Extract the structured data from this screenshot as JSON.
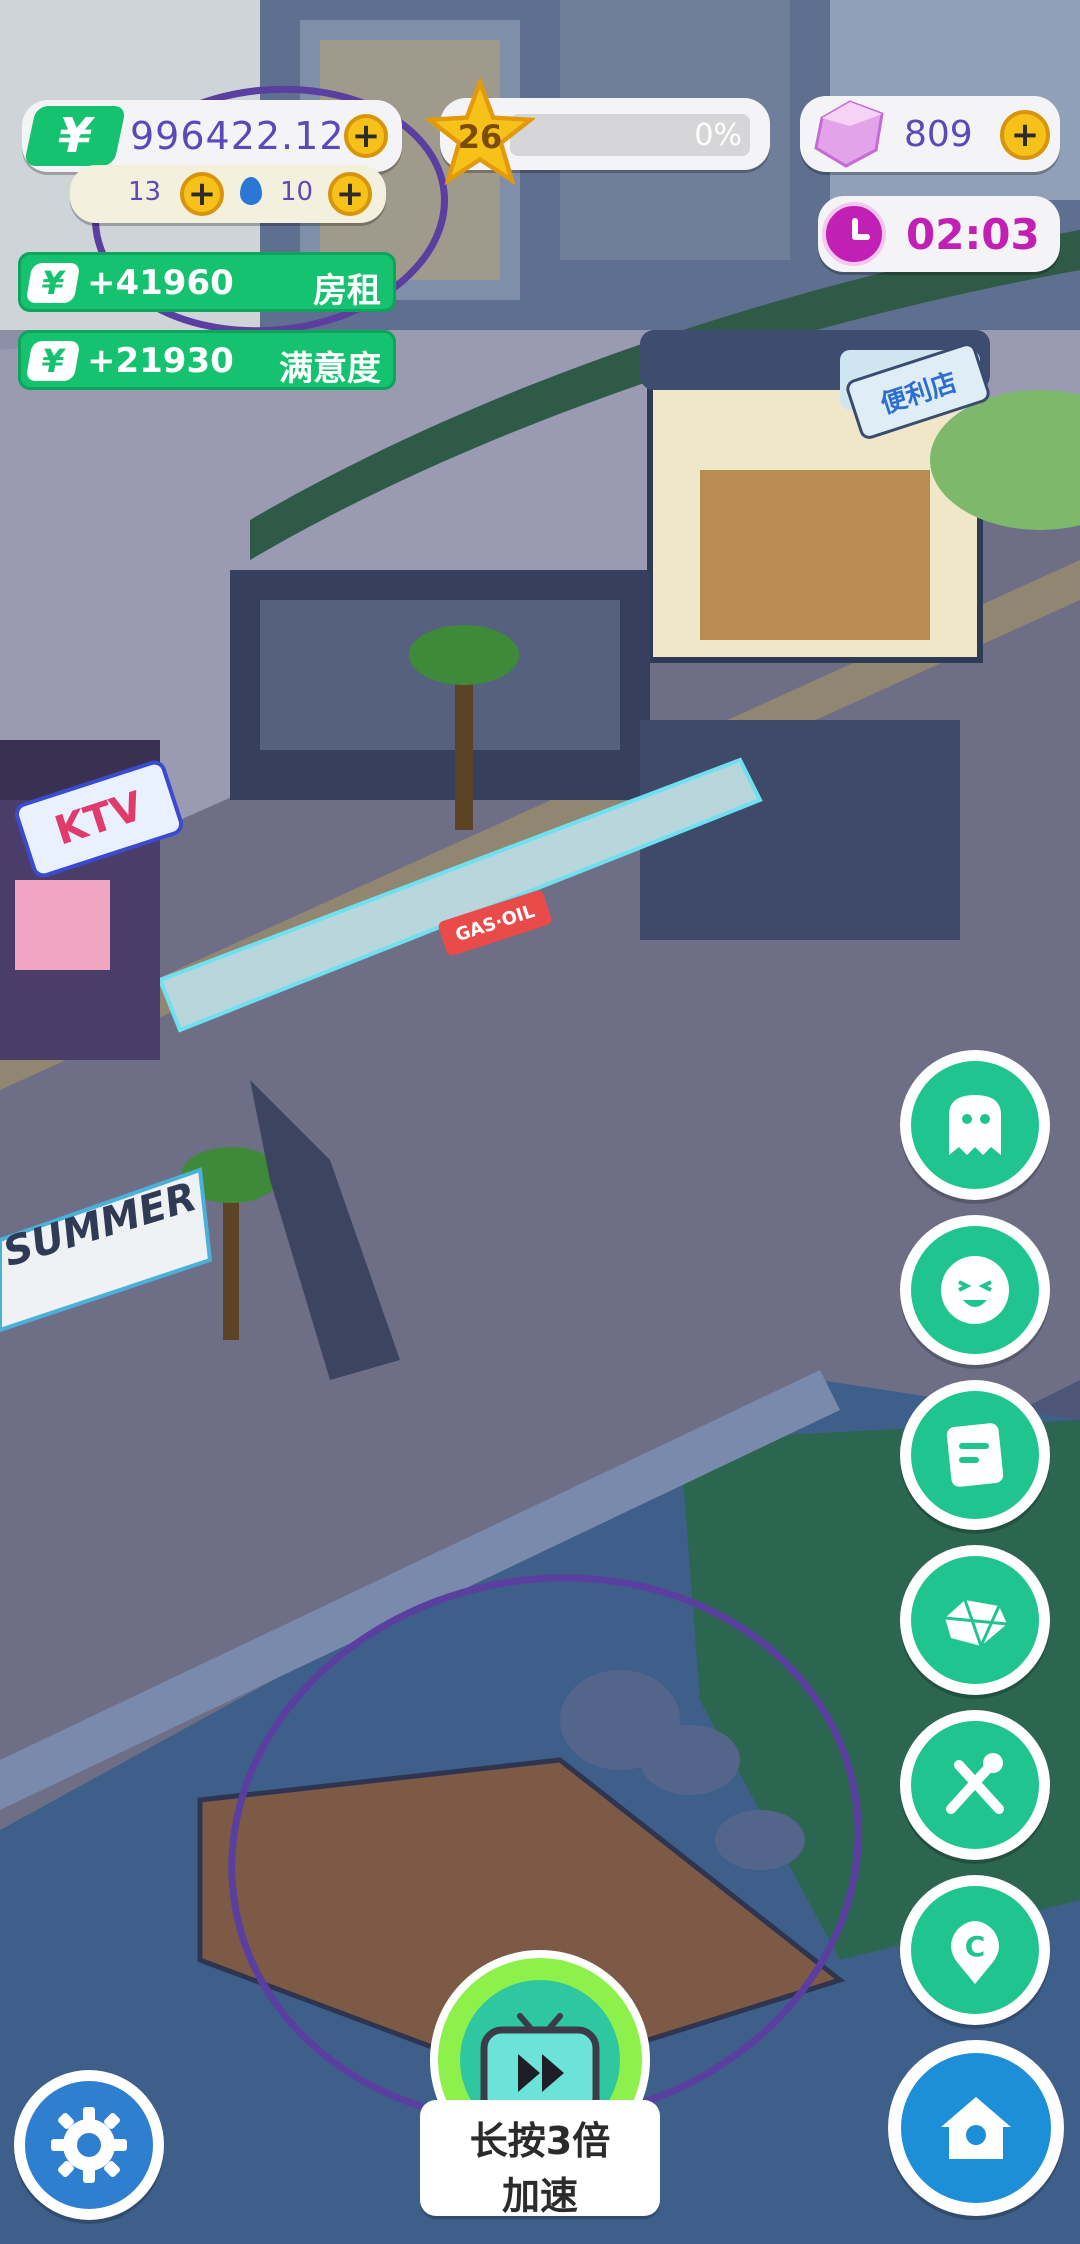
{
  "hud": {
    "money": "996422.12",
    "money_icon": "¥",
    "small_counter_a": "13",
    "small_counter_b": "10",
    "level": "26",
    "level_progress_label": "0%",
    "level_progress": 0,
    "gems": "809",
    "timer": "02:03"
  },
  "income": [
    {
      "icon": "¥",
      "amount": "+41960",
      "label": "房租"
    },
    {
      "icon": "¥",
      "amount": "+21930",
      "label": "满意度"
    }
  ],
  "signs": {
    "ktv": "KTV",
    "store": "便利店",
    "summer": "SUMMER",
    "gas": "GAS·OIL"
  },
  "right_buttons": [
    "ghost-icon",
    "smile-icon",
    "note-icon",
    "gem-icon",
    "tools-icon",
    "coin-location-icon"
  ],
  "speed_button": {
    "line1": "长按3倍",
    "line2": "加速"
  },
  "colors": {
    "green": "#15c26f",
    "teal": "#1fc48f",
    "gold": "#f6c21a",
    "purple_timer": "#c21fb5",
    "annotation": "#5b3fa0"
  }
}
